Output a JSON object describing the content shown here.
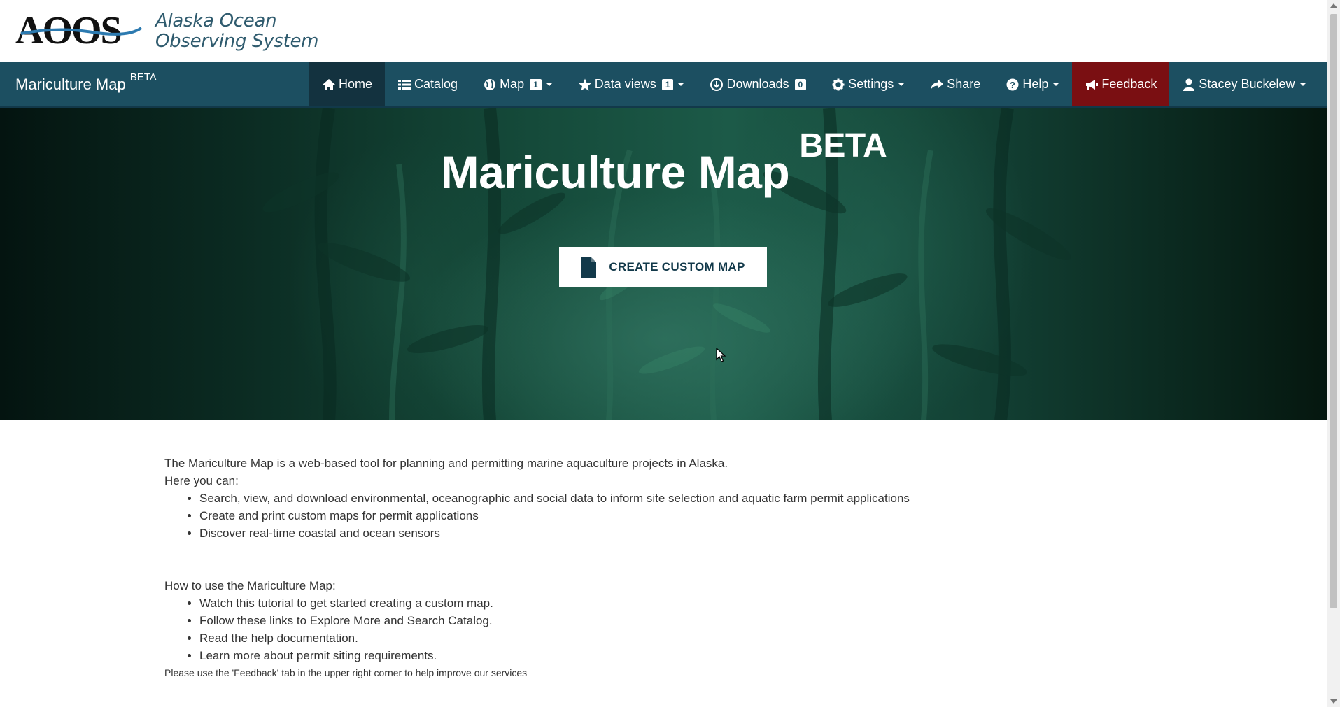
{
  "logo": {
    "mark_text": "AOOS",
    "tagline_line1": "Alaska Ocean",
    "tagline_line2": "Observing System"
  },
  "navbar": {
    "brand": "Mariculture Map",
    "brand_sup": "BETA",
    "items": [
      {
        "label": "Home",
        "icon": "home-icon",
        "active": true
      },
      {
        "label": "Catalog",
        "icon": "list-icon"
      },
      {
        "label": "Map",
        "icon": "globe-icon",
        "badge": "1",
        "dropdown": true
      },
      {
        "label": "Data views",
        "icon": "star-icon",
        "badge": "1",
        "dropdown": true
      },
      {
        "label": "Downloads",
        "icon": "download-icon",
        "badge": "0"
      },
      {
        "label": "Settings",
        "icon": "gear-icon",
        "dropdown": true
      },
      {
        "label": "Share",
        "icon": "share-icon"
      },
      {
        "label": "Help",
        "icon": "question-icon",
        "dropdown": true
      },
      {
        "label": "Feedback",
        "icon": "megaphone-icon",
        "color": "#7a0f12"
      },
      {
        "label": "Stacey Buckelew",
        "icon": "user-icon",
        "dropdown": true
      }
    ]
  },
  "hero": {
    "title": "Mariculture Map",
    "title_sup": "BETA",
    "cta_label": "CREATE CUSTOM MAP"
  },
  "content": {
    "intro": "The Mariculture Map is a web-based tool for planning and permitting marine aquaculture projects in Alaska.",
    "here_you_can": "Here you can:",
    "can_items": [
      "Search, view, and download environmental, oceanographic and social data to inform site selection and aquatic farm permit applications",
      "Create and print custom maps for permit applications",
      "Discover real-time coastal and ocean sensors"
    ],
    "how_to": "How to use the Mariculture Map:",
    "how_items": [
      "Watch this tutorial to get started creating a custom map.",
      "Follow these links to Explore More and Search Catalog.",
      "Read the help documentation.",
      "Learn more about permit siting requirements."
    ],
    "footer_note": "Please use the 'Feedback' tab in the upper right corner to help improve our services"
  },
  "colors": {
    "navbar": "#1c4f61",
    "nav_active": "#13323f",
    "feedback": "#7a0f12",
    "cta_text": "#12394a"
  }
}
